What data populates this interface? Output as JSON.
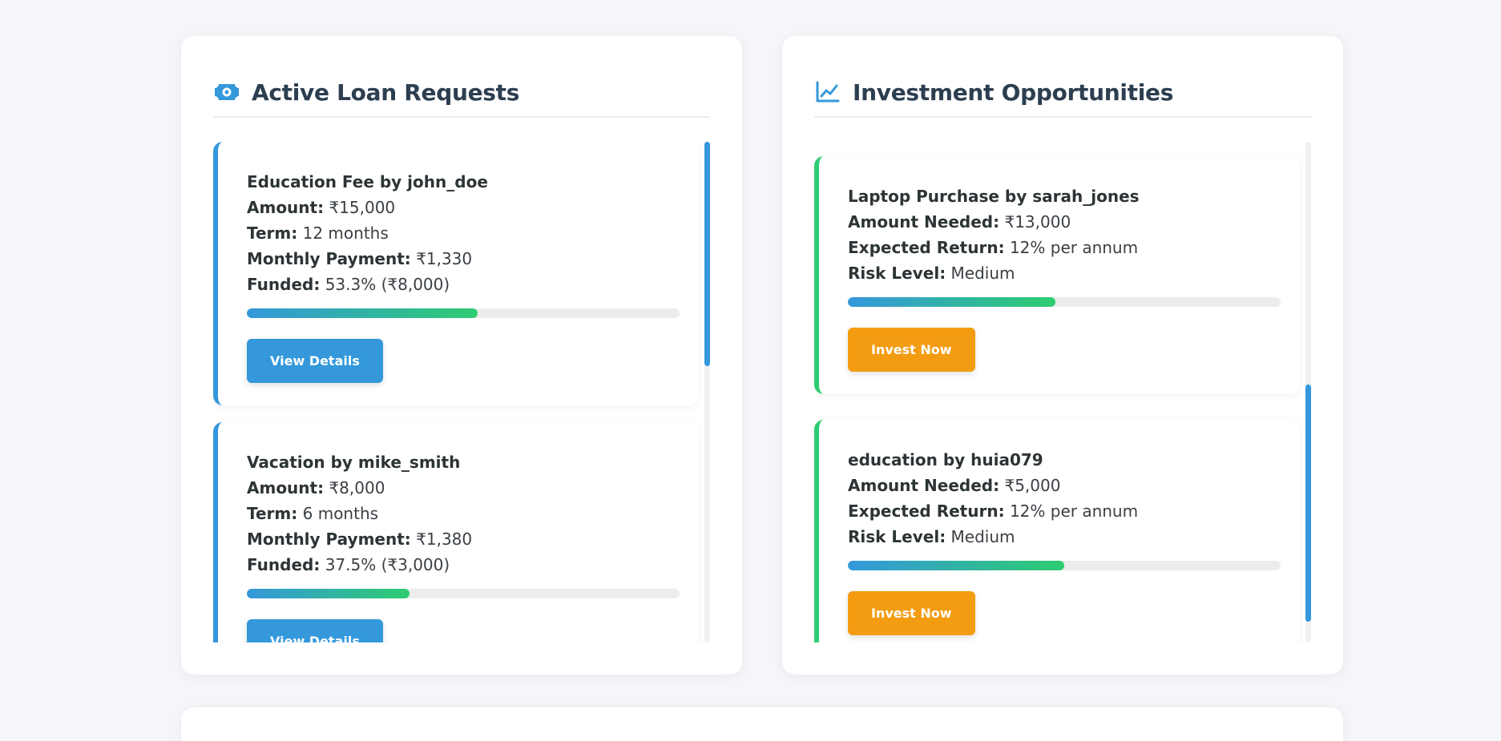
{
  "colors": {
    "primary": "#3498db",
    "success": "#2ecc71",
    "warning": "#f39c12",
    "title": "#2c3e50",
    "background": "#f5f6fa"
  },
  "loan_panel": {
    "title": "Active Loan Requests",
    "icon": "money-bill-icon",
    "cards": [
      {
        "title": "Education Fee by john_doe",
        "amount_label": "Amount:",
        "amount": "₹15,000",
        "term_label": "Term:",
        "term": "12 months",
        "monthly_label": "Monthly Payment:",
        "monthly": "₹1,330",
        "funded_label": "Funded:",
        "funded": "53.3% (₹8,000)",
        "progress_pct": 53.3,
        "button": "View Details"
      },
      {
        "title": "Vacation by mike_smith",
        "amount_label": "Amount:",
        "amount": "₹8,000",
        "term_label": "Term:",
        "term": "6 months",
        "monthly_label": "Monthly Payment:",
        "monthly": "₹1,380",
        "funded_label": "Funded:",
        "funded": "37.5% (₹3,000)",
        "progress_pct": 37.5,
        "button": "View Details"
      }
    ]
  },
  "invest_panel": {
    "title": "Investment Opportunities",
    "icon": "chart-line-icon",
    "cards": [
      {
        "title": "Laptop Purchase by sarah_jones",
        "needed_label": "Amount Needed:",
        "needed": "₹13,000",
        "return_label": "Expected Return:",
        "return": "12% per annum",
        "risk_label": "Risk Level:",
        "risk": "Medium",
        "progress_pct": 48,
        "button": "Invest Now"
      },
      {
        "title": "education by huia079",
        "needed_label": "Amount Needed:",
        "needed": "₹5,000",
        "return_label": "Expected Return:",
        "return": "12% per annum",
        "risk_label": "Risk Level:",
        "risk": "Medium",
        "progress_pct": 50,
        "button": "Invest Now"
      }
    ]
  }
}
